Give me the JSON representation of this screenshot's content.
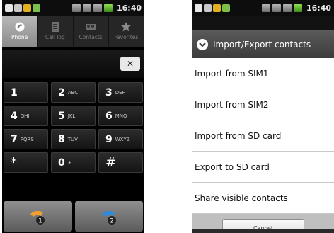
{
  "status_bar": {
    "time": "16:40"
  },
  "dialer": {
    "tabs": [
      {
        "label": "Phone",
        "icon": "phone-icon",
        "active": true
      },
      {
        "label": "Call log",
        "icon": "call-log-icon",
        "active": false
      },
      {
        "label": "Contacts",
        "icon": "contacts-icon",
        "active": false
      },
      {
        "label": "Favorites",
        "icon": "star-icon",
        "active": false
      }
    ],
    "keys": [
      {
        "num": "1",
        "letters": ""
      },
      {
        "num": "2",
        "letters": "ABC"
      },
      {
        "num": "3",
        "letters": "DEF"
      },
      {
        "num": "4",
        "letters": "GHI"
      },
      {
        "num": "5",
        "letters": "JKL"
      },
      {
        "num": "6",
        "letters": "MNO"
      },
      {
        "num": "7",
        "letters": "PQRS"
      },
      {
        "num": "8",
        "letters": "TUV"
      },
      {
        "num": "9",
        "letters": "WXYZ"
      },
      {
        "num": "*",
        "letters": ""
      },
      {
        "num": "0",
        "letters": "+"
      },
      {
        "num": "#",
        "letters": ""
      }
    ],
    "call_buttons": [
      {
        "sim": "1",
        "color": "#f0a030"
      },
      {
        "sim": "2",
        "color": "#2f8ad8"
      }
    ]
  },
  "dialog": {
    "title": "Import/Export contacts",
    "items": [
      "Import from SIM1",
      "Import from SIM2",
      "Import from SD card",
      "Export to SD card",
      "Share visible contacts"
    ],
    "cancel_label": "Cancel"
  },
  "colors": {
    "dialog_title_bg": "#4a4a4a",
    "screen_bg": "#000000"
  }
}
